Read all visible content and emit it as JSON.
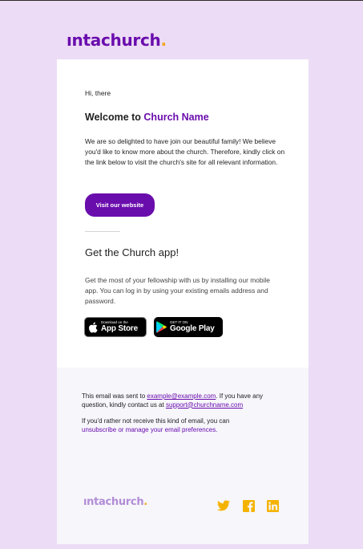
{
  "brand": {
    "name": "ıntachurch",
    "dot": "."
  },
  "body": {
    "greeting": "Hi, there",
    "welcome_prefix": "Welcome to",
    "church_name": "Church Name",
    "intro": "We are so delighted to have join our beautiful family! We believe you'd like to know more about the church. Therefore, kindly click on the link below to visit the church's site for all relevant information.",
    "cta_label": "Visit our website"
  },
  "app": {
    "heading": "Get the Church app!",
    "description": "Get the most of your fellowship with us by installing our mobile app. You can log in by using your existing emails address and password.",
    "appstore_small": "Download on the",
    "appstore_label": "App Store",
    "gplay_small": "GET IT ON",
    "gplay_label": "Google Play"
  },
  "footer": {
    "sent_prefix": "This email was sent to ",
    "recipient_email": "example@example.com",
    "question_text": ". If you have any question, kindly contact us at ",
    "support_email": "support@churchname.com",
    "rather_text": "If you'd rather not receive this kind of email, you can",
    "unsubscribe_link": "unsubscribe or manage your email preferences."
  },
  "colors": {
    "page_background": "#ecdcf5",
    "primary_purple": "#6a0dad",
    "accent_orange": "#f5a623",
    "social_icon": "#f5b301",
    "footer_background": "#f6f6fb"
  },
  "icons": [
    "apple-icon",
    "google-play-icon",
    "twitter-icon",
    "facebook-icon",
    "linkedin-icon"
  ]
}
